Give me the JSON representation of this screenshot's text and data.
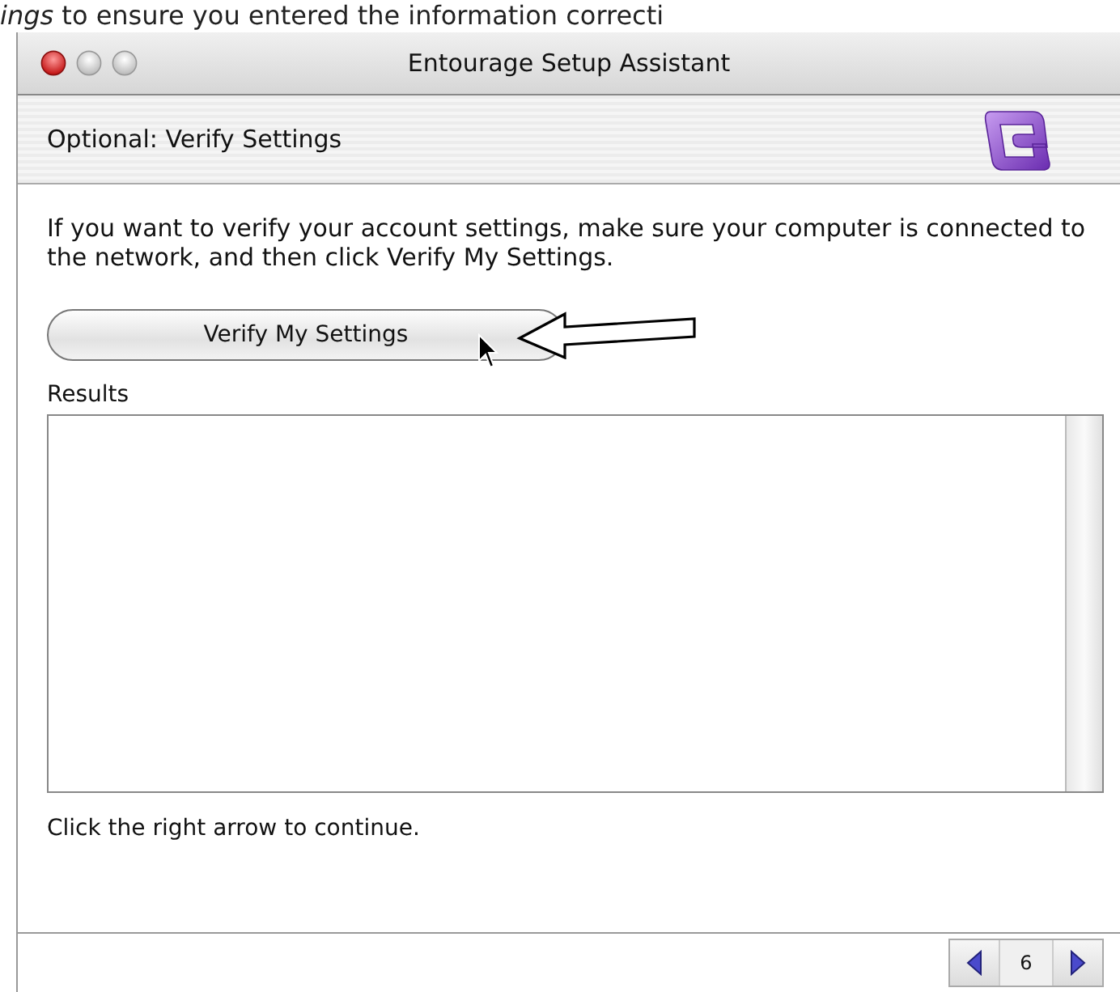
{
  "document_caption": "*ings* to ensure you entered the information correcti",
  "window": {
    "title": "Entourage Setup Assistant"
  },
  "header": {
    "title": "Optional: Verify Settings"
  },
  "instructions": "If you want to verify your account settings, make sure your computer is connected to the network, and then click Verify My Settings.",
  "verify_button": {
    "label": "Verify My Settings"
  },
  "results": {
    "label": "Results"
  },
  "footer_hint": "Click the right arrow to continue.",
  "pager": {
    "page": "6"
  }
}
